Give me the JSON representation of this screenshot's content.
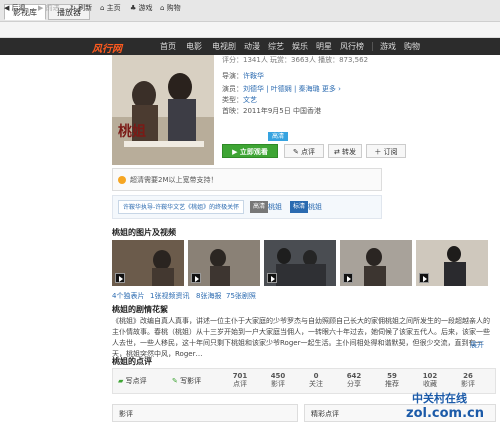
{
  "tabs": [
    "影视库",
    "播放器"
  ],
  "toolbar": {
    "back": "后退",
    "forward": "前进",
    "refresh": "刷新",
    "home": "主页",
    "games": "游戏",
    "shop": "购物"
  },
  "nav": {
    "logo": "风行网",
    "items": [
      "首页",
      "电影",
      "电视剧",
      "动漫",
      "综艺",
      "娱乐",
      "明星",
      "风行榜",
      "游戏",
      "购物"
    ]
  },
  "top_stats": "评分：1341人    玩赏：3663人    播放：873,562",
  "meta": {
    "director_label": "导演：",
    "director": "许鞍华",
    "cast_label": "演员：",
    "cast": "刘德华 | 叶德娴 | 秦海璐  更多 ›",
    "genre_label": "类型：",
    "genre": "文艺",
    "release_label": "首映：",
    "release": "2011年9月5日  中国香港"
  },
  "poster_title": "桃姐",
  "badge": "高清",
  "buttons": {
    "play": "立即观看",
    "review": "点评",
    "share": "转发",
    "subscribe": "订阅"
  },
  "notice": "超清需要2M以上宽带支持！",
  "download": {
    "label": "许鞍华执导-许鞍华文艺《桃姐》的终极关怀",
    "hd": "高清",
    "hd_title": "桃姐",
    "sd": "标清",
    "sd_title": "桃姐"
  },
  "photos": {
    "title": "桃姐的图片及视频",
    "links": [
      "4个独表片",
      "1张视频资讯",
      "8张海报",
      "75张剧照"
    ]
  },
  "story": {
    "title": "桃姐的剧情花絮",
    "text": "《桃姐》改编自真人真事，讲述一位主仆于大家庭的少爷罗杰与自幼照顾自己长大的家佣桃姐之间所发生的一段超越亲人的主仆情故事。春桃（桃姐）从十三岁开始到一户大家庭当佣人，一转眼六十年过去，她伺候了该家五代人。后来，该家一些人去世，一些人移民，这十年间只剩下桃姐和该家少爷Roger一起生活。主仆间相处得和谐默契，但很少交流，直到有一天，桃姐突然中风，Roger…",
    "more": "展开"
  },
  "reviews": {
    "title": "桃姐的点评",
    "write_review": "写点评",
    "write_shadow": "写影评",
    "stats": [
      {
        "value": "701",
        "label": "点评"
      },
      {
        "value": "450",
        "label": "影评"
      },
      {
        "value": "0",
        "label": "关注"
      },
      {
        "value": "642",
        "label": "分享"
      },
      {
        "value": "59",
        "label": "推荐"
      },
      {
        "value": "102",
        "label": "收藏"
      },
      {
        "value": "26",
        "label": "影评"
      }
    ]
  },
  "bottom": {
    "left": "影评",
    "right": "精彩点评"
  },
  "watermark": {
    "text": "中关村在线",
    "site": "zol.com.cn"
  },
  "colors": {
    "accent": "#ff5a1e",
    "play": "#3ea534",
    "link": "#2a6ab0"
  }
}
